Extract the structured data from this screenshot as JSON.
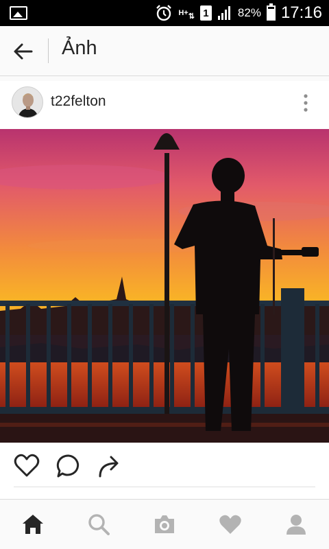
{
  "status_bar": {
    "network": "H+",
    "sim_slot": "1",
    "battery_percent": "82%",
    "battery_level": 0.82,
    "time": "17:16",
    "icons": [
      "gallery-icon",
      "alarm-icon",
      "data-hplus-icon",
      "sim-1-icon",
      "signal-icon",
      "battery-icon"
    ]
  },
  "header": {
    "title": "Ảnh",
    "back_icon": "arrow-left-icon"
  },
  "post": {
    "username": "t22felton",
    "avatar_icon": "profile-avatar",
    "menu_icon": "more-vertical-icon",
    "photo_subject": "silhouette-ukulele-sunset-marina"
  },
  "actions": {
    "icons": [
      "heart-outline-icon",
      "comment-icon",
      "share-icon"
    ]
  },
  "bottom_nav": {
    "items": [
      "home-icon",
      "search-icon",
      "camera-icon",
      "heart-icon",
      "profile-icon"
    ],
    "active": "home-icon"
  },
  "colors": {
    "accent_dark": "#262626",
    "inactive_icon": "#b3b3b3",
    "background": "#fafafa"
  }
}
